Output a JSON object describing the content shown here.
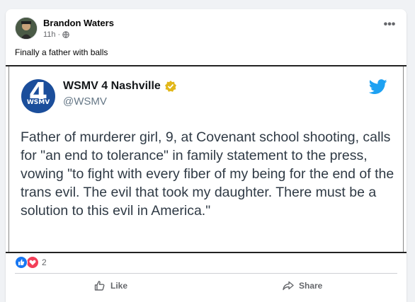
{
  "post": {
    "author": "Brandon Waters",
    "time": "11h",
    "visibility_icon": "globe-icon",
    "caption": "Finally a father with balls"
  },
  "tweet": {
    "account_name": "WSMV 4 Nashville",
    "handle": "@WSMV",
    "logo_number": "4",
    "logo_text": "WSMV",
    "verified_color": "#e2b719",
    "bird_color": "#1da1f2",
    "text": "Father of murderer girl, 9, at Covenant school shooting, calls for \"an end to tolerance\" in family statement to the press, vowing \"to fight with every fiber of my being for the end of the trans evil. The evil that took my daughter. There must be a solution to this evil in America.\""
  },
  "reactions": {
    "count": "2",
    "types": [
      "like",
      "love"
    ]
  },
  "actions": {
    "like_label": "Like",
    "share_label": "Share"
  }
}
